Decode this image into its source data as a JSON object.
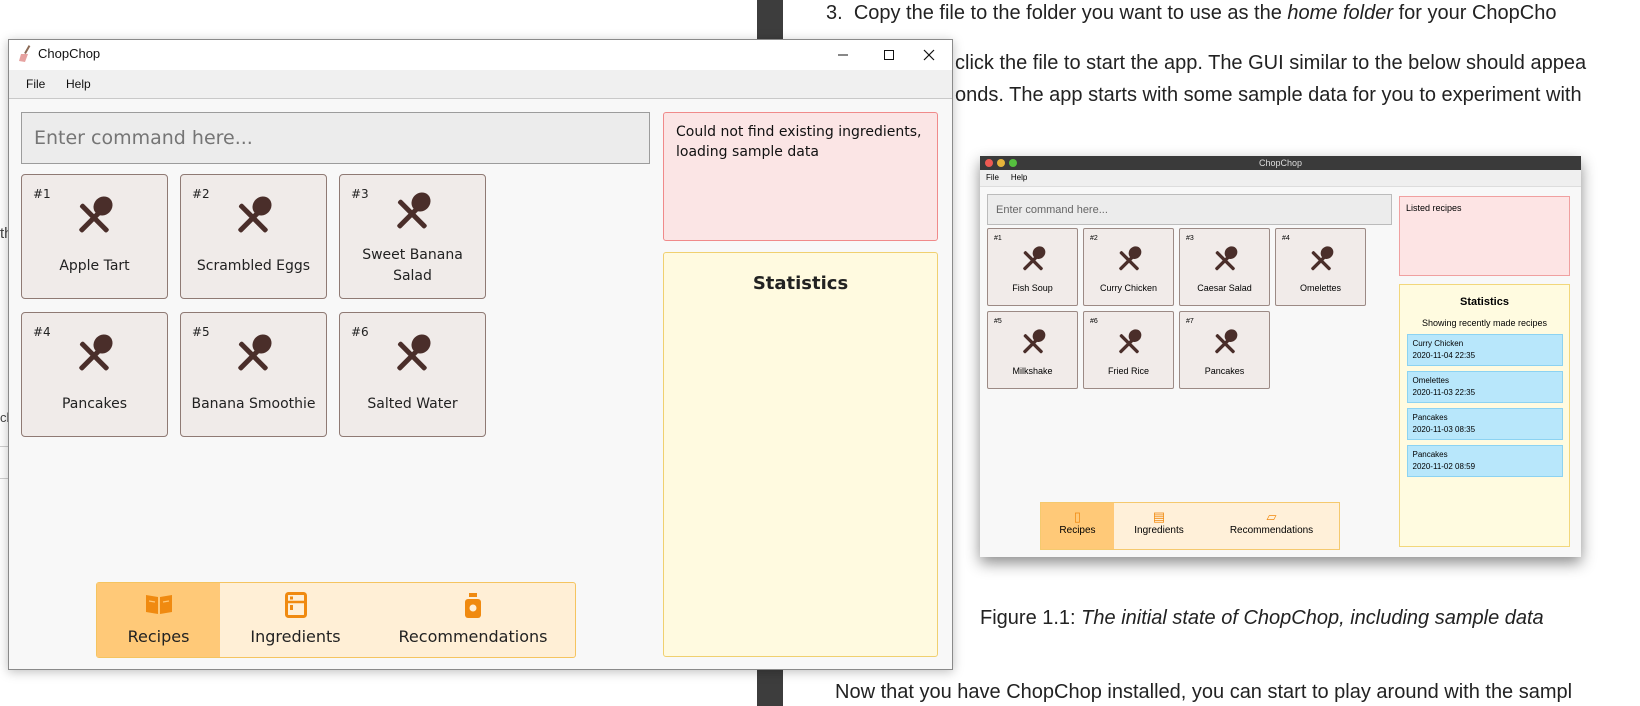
{
  "window": {
    "title": "ChopChop",
    "menu": [
      "File",
      "Help"
    ],
    "command_placeholder": "Enter command here...",
    "result_message": "Could not find existing ingredients, loading sample data",
    "statistics_title": "Statistics",
    "recipes": [
      {
        "number": "#1",
        "name": "Apple Tart"
      },
      {
        "number": "#2",
        "name": "Scrambled Eggs"
      },
      {
        "number": "#3",
        "name": "Sweet Banana Salad"
      },
      {
        "number": "#4",
        "name": "Pancakes"
      },
      {
        "number": "#5",
        "name": "Banana Smoothie"
      },
      {
        "number": "#6",
        "name": "Salted Water"
      }
    ],
    "tabs": [
      {
        "label": "Recipes",
        "active": true,
        "icon": "book-icon"
      },
      {
        "label": "Ingredients",
        "active": false,
        "icon": "fridge-icon"
      },
      {
        "label": "Recommendations",
        "active": false,
        "icon": "jar-icon"
      }
    ],
    "colors": {
      "card_bg": "#f0ebe9",
      "icon": "#4a2e2a",
      "result_bg": "#fbe5e5",
      "stats_bg": "#fffae0",
      "tab_active": "#ffc978",
      "tab_icon": "#f08a10"
    }
  },
  "document": {
    "step_number": "3.",
    "step_text_a": "Copy the file to the folder you want to use as the ",
    "step_text_em": "home folder",
    "step_text_b": " for your ChopCho",
    "line2": "click the file to start the app. The GUI similar to the below should appea",
    "line3": "onds. The app starts with some sample data for you to experiment with",
    "caption_a": "Figure 1.1: ",
    "caption_em": "The initial state of ChopChop, including sample data",
    "bottom_line": "Now that you have ChopChop installed, you can start to play around with the sampl",
    "left_fragment_1": "th",
    "left_fragment_2": "ck"
  },
  "figure": {
    "title": "ChopChop",
    "menu": [
      "File",
      "Help"
    ],
    "command_placeholder": "Enter command here...",
    "result_message": "Listed recipes",
    "statistics_title": "Statistics",
    "statistics_subtitle": "Showing recently made recipes",
    "recent": [
      {
        "name": "Curry Chicken",
        "time": "2020-11-04 22:35"
      },
      {
        "name": "Omelettes",
        "time": "2020-11-03 22:35"
      },
      {
        "name": "Pancakes",
        "time": "2020-11-03 08:35"
      },
      {
        "name": "Pancakes",
        "time": "2020-11-02 08:59"
      }
    ],
    "recipes": [
      {
        "number": "#1",
        "name": "Fish Soup"
      },
      {
        "number": "#2",
        "name": "Curry Chicken"
      },
      {
        "number": "#3",
        "name": "Caesar Salad"
      },
      {
        "number": "#4",
        "name": "Omelettes"
      },
      {
        "number": "#5",
        "name": "Milkshake"
      },
      {
        "number": "#6",
        "name": "Fried Rice"
      },
      {
        "number": "#7",
        "name": "Pancakes"
      }
    ],
    "tabs": [
      "Recipes",
      "Ingredients",
      "Recommendations"
    ]
  }
}
